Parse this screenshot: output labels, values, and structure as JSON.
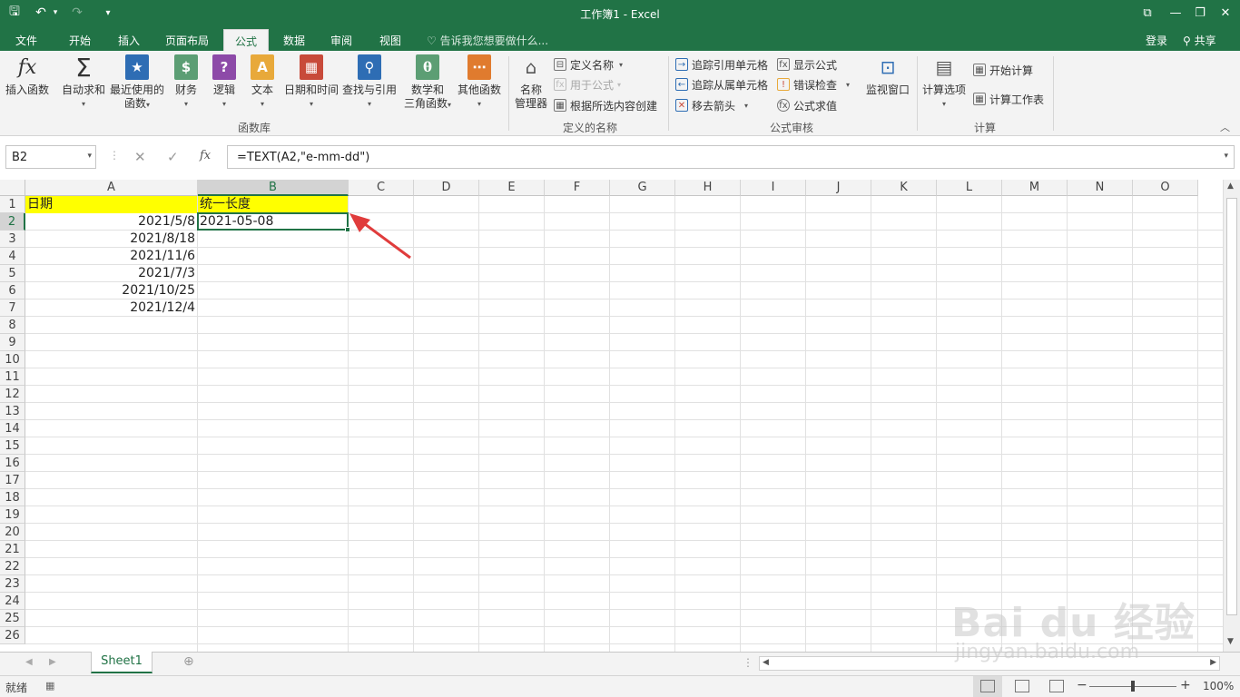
{
  "app": {
    "window_title": "工作簿1 - Excel",
    "qat": {
      "save": "🖫",
      "undo": "↶",
      "redo": "↷",
      "customize": "▾"
    },
    "window_controls": {
      "ribbon_display": "⧉",
      "minimize": "—",
      "restore": "❐",
      "close": "✕"
    }
  },
  "tabs": [
    "文件",
    "开始",
    "插入",
    "页面布局",
    "公式",
    "数据",
    "审阅",
    "视图"
  ],
  "active_tab": "公式",
  "tell_me": "告诉我您想要做什么...",
  "account": {
    "signin": "登录",
    "share": "共享"
  },
  "ribbon": {
    "function_library": {
      "label": "函数库",
      "insert_function": "插入函数",
      "autosum": "自动求和",
      "recent_line1": "最近使用的",
      "recent_line2": "函数",
      "financial": "财务",
      "logical": "逻辑",
      "text": "文本",
      "datetime": "日期和时间",
      "lookup": "查找与引用",
      "math_line1": "数学和",
      "math_line2": "三角函数",
      "more": "其他函数"
    },
    "defined_names": {
      "label": "定义的名称",
      "name_manager_line1": "名称",
      "name_manager_line2": "管理器",
      "define_name": "定义名称",
      "use_in_formula": "用于公式",
      "create_from_selection": "根据所选内容创建"
    },
    "formula_auditing": {
      "label": "公式审核",
      "trace_precedents": "追踪引用单元格",
      "trace_dependents": "追踪从属单元格",
      "remove_arrows": "移去箭头",
      "show_formulas": "显示公式",
      "error_checking": "错误检查",
      "evaluate_formula": "公式求值",
      "watch_window": "监视窗口"
    },
    "calculation": {
      "label": "计算",
      "options": "计算选项",
      "calc_now": "开始计算",
      "calc_sheet": "计算工作表"
    }
  },
  "formula_bar": {
    "name_box": "B2",
    "fx": "fx",
    "formula": "=TEXT(A2,\"e-mm-dd\")"
  },
  "sheet": {
    "columns": [
      "A",
      "B",
      "C",
      "D",
      "E",
      "F",
      "G",
      "H",
      "I",
      "J",
      "K",
      "L",
      "M",
      "N",
      "O"
    ],
    "rows": [
      "1",
      "2",
      "3",
      "4",
      "5",
      "6",
      "7",
      "8",
      "9",
      "10",
      "11",
      "12",
      "13",
      "14",
      "15",
      "16",
      "17",
      "18",
      "19",
      "20",
      "21",
      "22",
      "23",
      "24",
      "25",
      "26"
    ],
    "cells": {
      "A1": "日期",
      "B1": "统一长度",
      "A2": "2021/5/8",
      "A3": "2021/8/18",
      "A4": "2021/11/6",
      "A5": "2021/7/3",
      "A6": "2021/10/25",
      "A7": "2021/12/4",
      "B2": "2021-05-08"
    },
    "header_fill": "#ffff00",
    "selected_cell": "B2",
    "annotation_arrow_color": "#e03c3c"
  },
  "sheet_tabs": [
    "Sheet1"
  ],
  "status": {
    "ready": "就绪",
    "zoom": "100%"
  },
  "watermark": {
    "logo": "Bai du 经验",
    "url": "jingyan.baidu.com"
  }
}
